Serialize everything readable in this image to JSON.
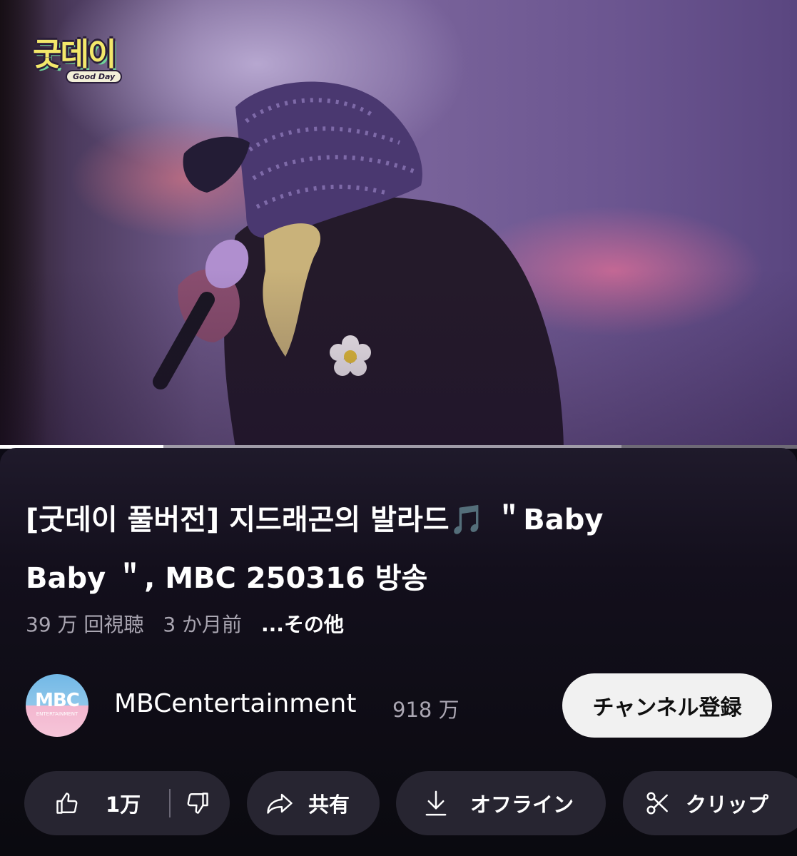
{
  "video": {
    "logo_text": "굿데이",
    "logo_subtitle": "Good Day",
    "progress_played": 0.205,
    "progress_buffered": 0.78
  },
  "title_line1": "[굿데이 풀버전] 지드래곤의 발라드🎵 ＂Baby",
  "title_line2": "Baby ＂, MBC 250316 방송",
  "meta": {
    "views": "39 万 回視聴",
    "age": "3 か月前",
    "more": "...その他"
  },
  "channel": {
    "avatar_text": "MBC",
    "avatar_subtext": "ENTERTAINMENT",
    "name": "MBCentertainment",
    "subscribers": "918 万",
    "subscribe_label": "チャンネル登録"
  },
  "actions": {
    "like_count": "1万",
    "share_label": "共有",
    "offline_label": "オフライン",
    "clip_label": "クリップ"
  },
  "colors": {
    "background": "#0c0a14",
    "pill": "#272531",
    "subscribe_bg": "#f1f1f1",
    "secondary_text": "#aaa6b2"
  }
}
